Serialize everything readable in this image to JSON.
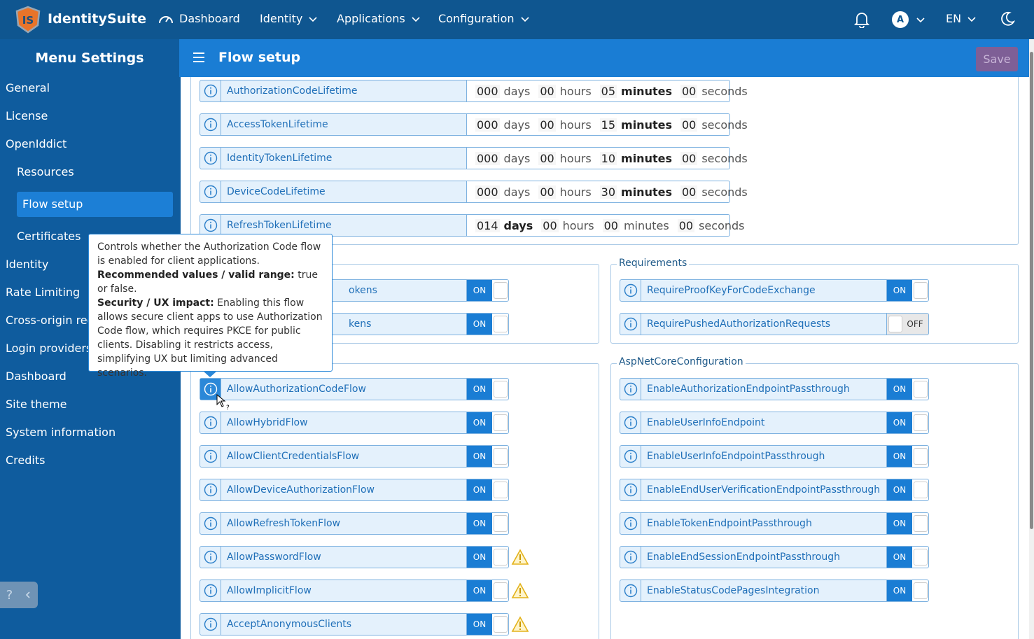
{
  "topbar": {
    "brand": "IdentitySuite",
    "nav": [
      "Dashboard",
      "Identity",
      "Applications",
      "Configuration"
    ],
    "avatar_letter": "A",
    "language": "EN"
  },
  "sidebar": {
    "title": "Menu Settings",
    "items": [
      "General",
      "License",
      "OpenIddict",
      "Resources",
      "Flow setup",
      "Certificates",
      "Identity",
      "Rate Limiting",
      "Cross-origin req",
      "Login providers",
      "Dashboard",
      "Site theme",
      "System information",
      "Credits"
    ],
    "help_label": "?"
  },
  "header": {
    "title": "Flow setup",
    "save_label": "Save"
  },
  "lifetimes": [
    {
      "name": "AuthorizationCodeLifetime",
      "days": "000",
      "hours": "00",
      "minutes": "05",
      "seconds": "00",
      "bold": "minutes"
    },
    {
      "name": "AccessTokenLifetime",
      "days": "000",
      "hours": "00",
      "minutes": "15",
      "seconds": "00",
      "bold": "minutes"
    },
    {
      "name": "IdentityTokenLifetime",
      "days": "000",
      "hours": "00",
      "minutes": "10",
      "seconds": "00",
      "bold": "minutes"
    },
    {
      "name": "DeviceCodeLifetime",
      "days": "000",
      "hours": "00",
      "minutes": "30",
      "seconds": "00",
      "bold": "minutes"
    },
    {
      "name": "RefreshTokenLifetime",
      "days": "014",
      "hours": "00",
      "minutes": "00",
      "seconds": "00",
      "bold": "days"
    }
  ],
  "units": {
    "days": "days",
    "hours": "hours",
    "minutes": "minutes",
    "seconds": "seconds"
  },
  "tokens_partial": [
    {
      "name": "okens",
      "state": "ON"
    },
    {
      "name": "kens",
      "state": "ON"
    }
  ],
  "requirements": {
    "legend": "Requirements",
    "items": [
      {
        "name": "RequireProofKeyForCodeExchange",
        "state": "ON"
      },
      {
        "name": "RequirePushedAuthorizationRequests",
        "state": "OFF"
      }
    ]
  },
  "flows": [
    {
      "name": "AllowAuthorizationCodeFlow",
      "state": "ON",
      "warn": false
    },
    {
      "name": "AllowHybridFlow",
      "state": "ON",
      "warn": false
    },
    {
      "name": "AllowClientCredentialsFlow",
      "state": "ON",
      "warn": false
    },
    {
      "name": "AllowDeviceAuthorizationFlow",
      "state": "ON",
      "warn": false
    },
    {
      "name": "AllowRefreshTokenFlow",
      "state": "ON",
      "warn": false
    },
    {
      "name": "AllowPasswordFlow",
      "state": "ON",
      "warn": true
    },
    {
      "name": "AllowImplicitFlow",
      "state": "ON",
      "warn": true
    },
    {
      "name": "AcceptAnonymousClients",
      "state": "ON",
      "warn": true
    }
  ],
  "aspnet": {
    "legend": "AspNetCoreConfiguration",
    "items": [
      {
        "name": "EnableAuthorizationEndpointPassthrough",
        "state": "ON"
      },
      {
        "name": "EnableUserInfoEndpoint",
        "state": "ON"
      },
      {
        "name": "EnableUserInfoEndpointPassthrough",
        "state": "ON"
      },
      {
        "name": "EnableEndUserVerificationEndpointPassthrough",
        "state": "ON"
      },
      {
        "name": "EnableTokenEndpointPassthrough",
        "state": "ON"
      },
      {
        "name": "EnableEndSessionEndpointPassthrough",
        "state": "ON"
      },
      {
        "name": "EnableStatusCodePagesIntegration",
        "state": "ON"
      }
    ]
  },
  "tooltip": {
    "intro": "Controls whether the Authorization Code flow is enabled for client applications.",
    "rec_label": "Recommended values / valid range:",
    "rec_text": " true or false.",
    "sec_label": "Security / UX impact:",
    "sec_text": " Enabling this flow allows secure client apps to use Authorization Code flow, which requires PKCE for public clients. Disabling it restricts access, simplifying UX but limiting advanced scenarios."
  },
  "colors": {
    "accent": "#1a7dd4",
    "sidebar": "#0f5c9e",
    "topbar": "#0f5690",
    "save": "#7e5f96"
  }
}
